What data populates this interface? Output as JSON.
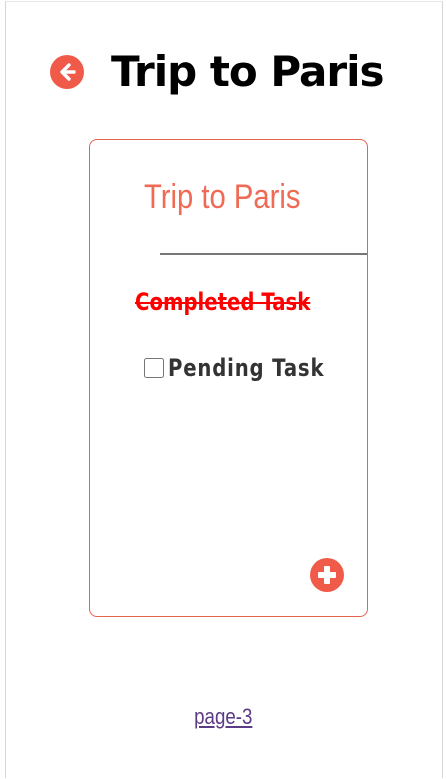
{
  "header": {
    "back_icon": "arrow-left-circle-icon",
    "title": "Trip to Paris"
  },
  "card": {
    "title": "Trip to Paris",
    "tasks": [
      {
        "label": "Completed Task",
        "status": "completed"
      },
      {
        "label": "Pending Task",
        "status": "pending",
        "checked": false
      }
    ],
    "add_icon": "plus-circle-icon"
  },
  "footer": {
    "page_link": "page-3"
  },
  "colors": {
    "accent": "#ef5b48",
    "card_border": "#e4644f",
    "card_title": "#ef6b55",
    "completed_task": "#ff0000",
    "pending_task": "#333333",
    "link": "#5b3a86"
  }
}
